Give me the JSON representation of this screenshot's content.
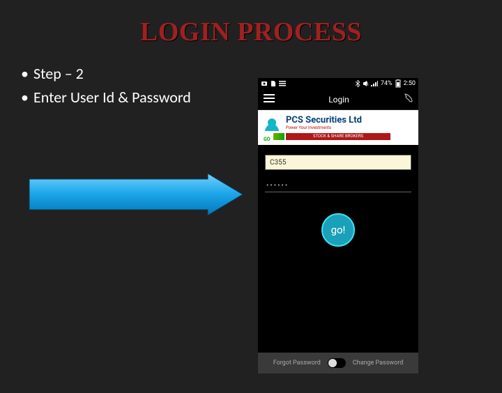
{
  "title": "LOGIN PROCESS",
  "bullets": [
    "Step – 2",
    "Enter User Id & Password"
  ],
  "phone": {
    "status": {
      "battery": "74%",
      "time": "2:50"
    },
    "nav": {
      "title": "Login"
    },
    "logo": {
      "line1": "PCS Securities Ltd",
      "line2": "Power Your Investments",
      "strip": "STOCK & SHARE BROKERS",
      "go": "GO"
    },
    "userId": "C355",
    "pwdMasked": "••••••",
    "goLabel": "go!",
    "footer": {
      "left": "Forgot Password",
      "right": "Change Password"
    }
  }
}
